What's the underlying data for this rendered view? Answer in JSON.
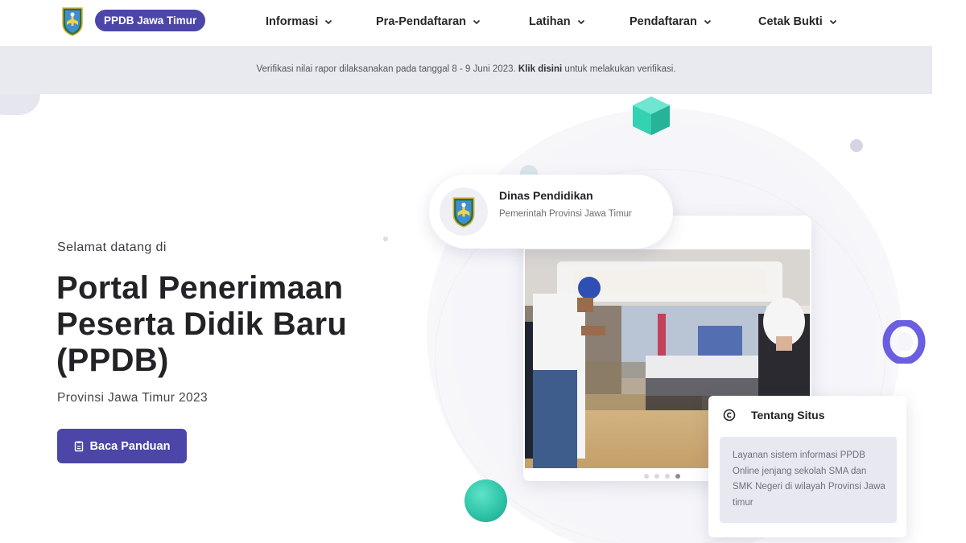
{
  "nav": {
    "brand": "PPDB Jawa Timur",
    "menu": [
      {
        "label": "Informasi"
      },
      {
        "label": "Pra-Pendaftaran"
      },
      {
        "label": "Latihan"
      },
      {
        "label": "Pendaftaran"
      },
      {
        "label": "Cetak Bukti"
      }
    ]
  },
  "banner": {
    "text_before": "Verifikasi nilai rapor dilaksanakan pada tanggal 8 - 9 Juni 2023. ",
    "link": "Klik disini",
    "text_after": " untuk melakukan verifikasi."
  },
  "hero": {
    "welcome": "Selamat datang di",
    "title": "Portal Penerimaan Peserta Didik Baru (PPDB)",
    "subtitle": "Provinsi Jawa Timur 2023",
    "button": "Baca Panduan"
  },
  "org_card": {
    "title": "Dinas Pendidikan",
    "subtitle": "Pemerintah Provinsi Jawa Timur"
  },
  "about_card": {
    "title": "Tentang Situs",
    "text": "Layanan sistem informasi PPDB Online jenjang sekolah SMA dan SMK Negeri di wilayah Provinsi Jawa timur"
  },
  "icons": {
    "logo": "east-java-crest-icon",
    "chevron": "chevron-down-icon",
    "guide": "document-icon",
    "about": "copyright-circle-icon"
  },
  "colors": {
    "primary": "#4c46a8",
    "banner_bg": "#e9e9f0",
    "teal": "#2fc4a8",
    "ring": "#6a5fe0"
  }
}
